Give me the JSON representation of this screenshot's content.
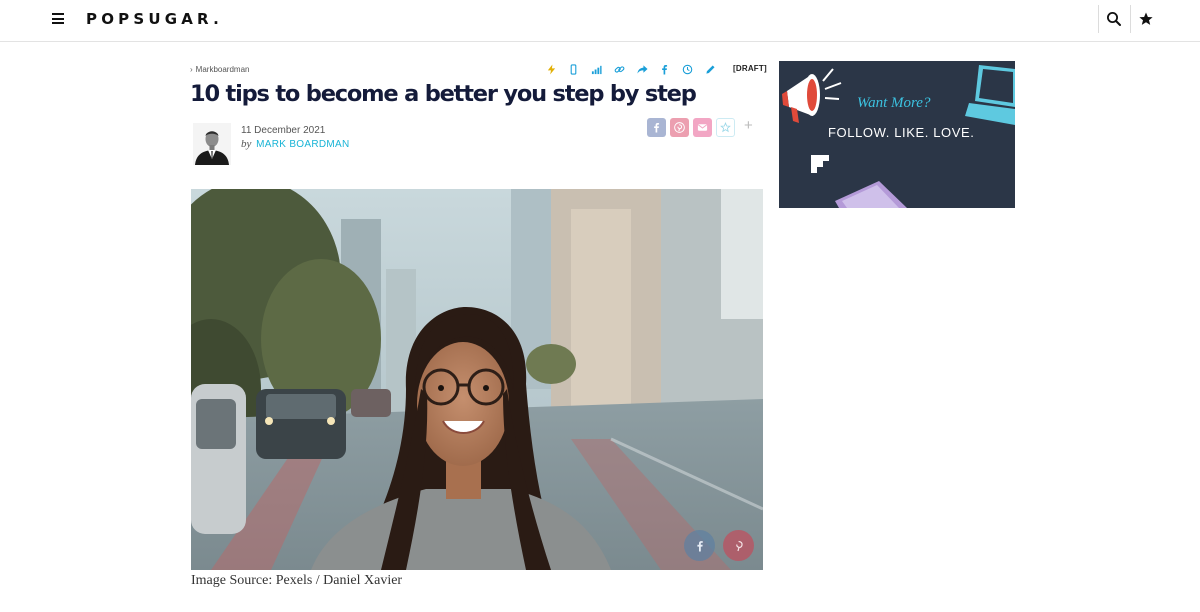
{
  "header": {
    "logo": "POPSUGAR.",
    "menu_icon": "hamburger-menu-icon",
    "search_icon": "search-icon",
    "favorites_icon": "star-icon"
  },
  "article": {
    "breadcrumb": "Markboardman",
    "toolbar_icons": [
      "lightning-icon",
      "mobile-icon",
      "stats-icon",
      "link-icon",
      "share-arrow-icon",
      "facebook-icon",
      "clock-icon",
      "edit-pencil-icon"
    ],
    "status": "[DRAFT]",
    "title": "10 tips to become a better you step by step",
    "date": "11 December 2021",
    "by": "by",
    "author": "MARK BOARDMAN",
    "share_buttons": [
      "facebook-icon",
      "pinterest-icon",
      "email-icon",
      "star-outline-icon"
    ],
    "share_more": "+",
    "image_caption": "Image Source: Pexels / Daniel Xavier",
    "image_share_buttons": [
      "facebook-icon",
      "pinterest-icon"
    ]
  },
  "sidebar_ad": {
    "heading": "Want More?",
    "tagline": "FOLLOW. LIKE. LOVE."
  },
  "colors": {
    "title": "#141b3a",
    "author_link": "#19b4d6",
    "toolbar_icons": "#1a9fd8",
    "facebook": "#3b5998",
    "pinterest": "#cb2027",
    "ad_background": "#2b3647",
    "ad_heading": "#3cc2e0"
  }
}
